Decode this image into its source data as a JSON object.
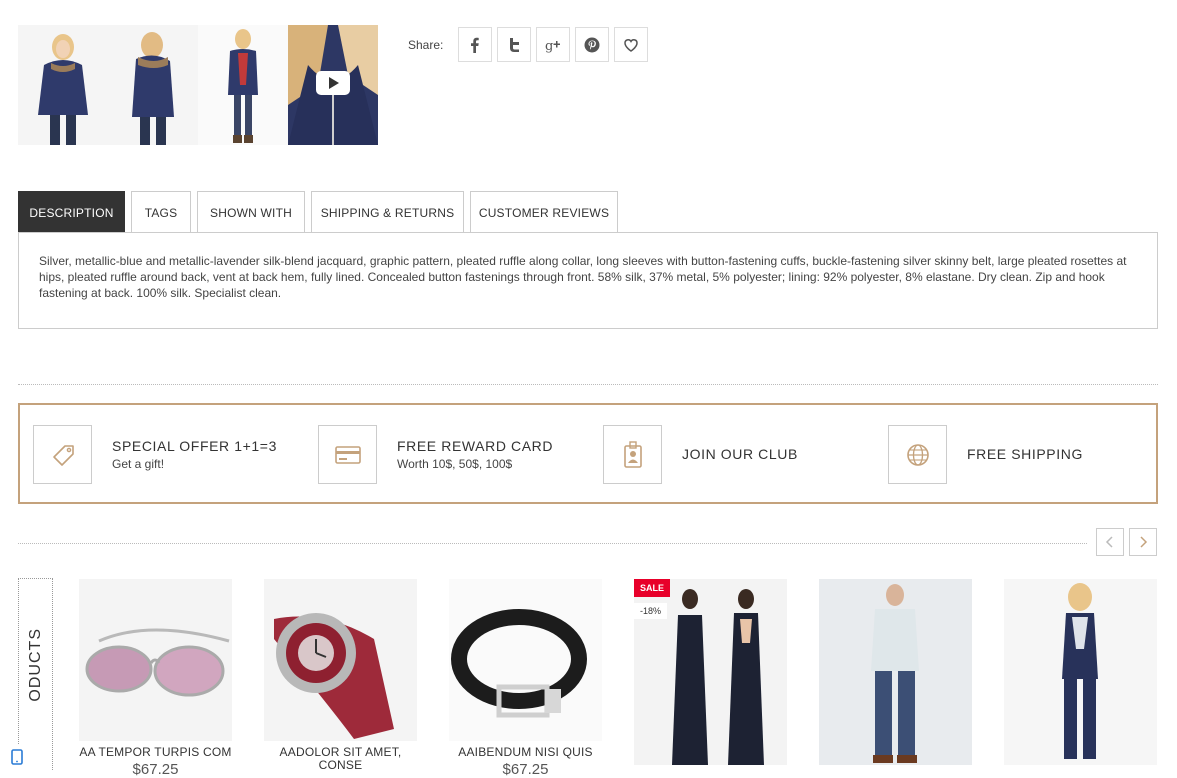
{
  "thumbnails": [
    {
      "name": "jacket-front"
    },
    {
      "name": "jacket-side"
    },
    {
      "name": "jacket-open"
    },
    {
      "name": "jacket-closeup-video"
    }
  ],
  "share": {
    "label": "Share:",
    "buttons": [
      "facebook-icon",
      "twitter-icon",
      "google-plus-icon",
      "pinterest-icon",
      "heart-icon"
    ]
  },
  "tabs": [
    {
      "label": "DESCRIPTION",
      "active": true
    },
    {
      "label": "TAGS"
    },
    {
      "label": "SHOWN WITH"
    },
    {
      "label": "SHIPPING & RETURNS"
    },
    {
      "label": "CUSTOMER REVIEWS"
    }
  ],
  "description": "Silver, metallic-blue and metallic-lavender silk-blend jacquard, graphic pattern, pleated ruffle along collar, long sleeves with button-fastening cuffs, buckle-fastening silver skinny belt, large pleated rosettes at hips, pleated ruffle around back, vent at back hem, fully lined. Concealed button fastenings through front. 58% silk, 37% metal, 5% polyester; lining: 92% polyester, 8% elastane. Dry clean. Zip and hook fastening at back. 100% silk. Specialist clean.",
  "benefits": [
    {
      "icon": "tag-icon",
      "title": "SPECIAL OFFER 1+1=3",
      "subtitle": "Get a gift!"
    },
    {
      "icon": "card-icon",
      "title": "FREE REWARD CARD",
      "subtitle": "Worth 10$, 50$, 100$"
    },
    {
      "icon": "id-badge-icon",
      "title": "JOIN OUR CLUB",
      "subtitle": ""
    },
    {
      "icon": "globe-icon",
      "title": "FREE SHIPPING",
      "subtitle": ""
    }
  ],
  "related": {
    "vertical_label": "ODUCTS",
    "products": [
      {
        "name": "AA TEMPOR TURPIS COM",
        "price": "$67.25"
      },
      {
        "name": "AADOLOR SIT AMET, CONSE",
        "price": ""
      },
      {
        "name": "AAIBENDUM NISI QUIS",
        "price": "$67.25"
      },
      {
        "name": "",
        "price": "",
        "sale": "SALE",
        "discount": "-18%"
      },
      {
        "name": "",
        "price": ""
      },
      {
        "name": "",
        "price": ""
      }
    ]
  },
  "colors": {
    "accent": "#c4a27c",
    "sale": "#e8002a",
    "active_tab": "#333333"
  }
}
